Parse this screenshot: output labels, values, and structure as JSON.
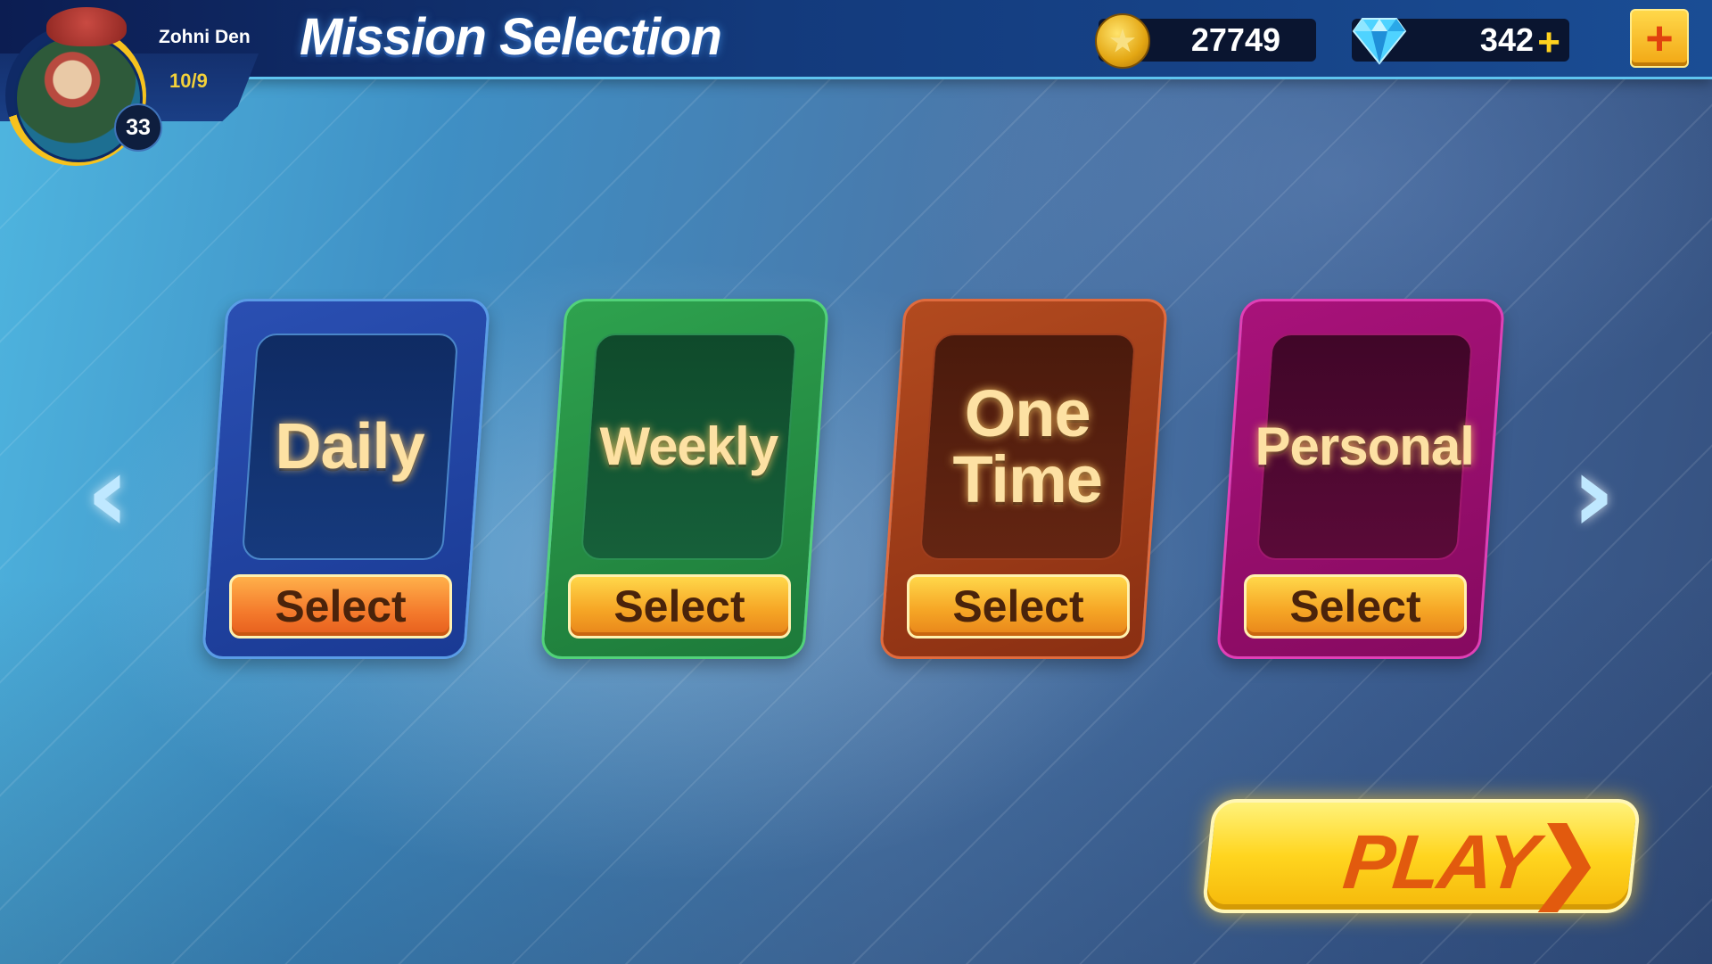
{
  "header": {
    "title": "Mission Selection",
    "player": {
      "name": "Zohni Den",
      "progress": "10/9",
      "level": "33"
    },
    "coins": {
      "value": "27749",
      "icon": "coin-icon"
    },
    "gems": {
      "value": "342",
      "icon": "gem-icon",
      "add_symbol": "+"
    },
    "shop_symbol": "+"
  },
  "navigation": {
    "prev_symbol": "‹",
    "next_symbol": "›"
  },
  "missions": [
    {
      "label": "Daily",
      "button": "Select",
      "color": "#1f45a3"
    },
    {
      "label": "Weekly",
      "button": "Select",
      "color": "#24913f"
    },
    {
      "label_line1": "One",
      "label_line2": "Time",
      "button": "Select",
      "color": "#9e3a18"
    },
    {
      "label": "Personal",
      "button": "Select",
      "color": "#9a0e6e"
    }
  ],
  "play": {
    "label": "PLAY",
    "symbol": "❯"
  }
}
